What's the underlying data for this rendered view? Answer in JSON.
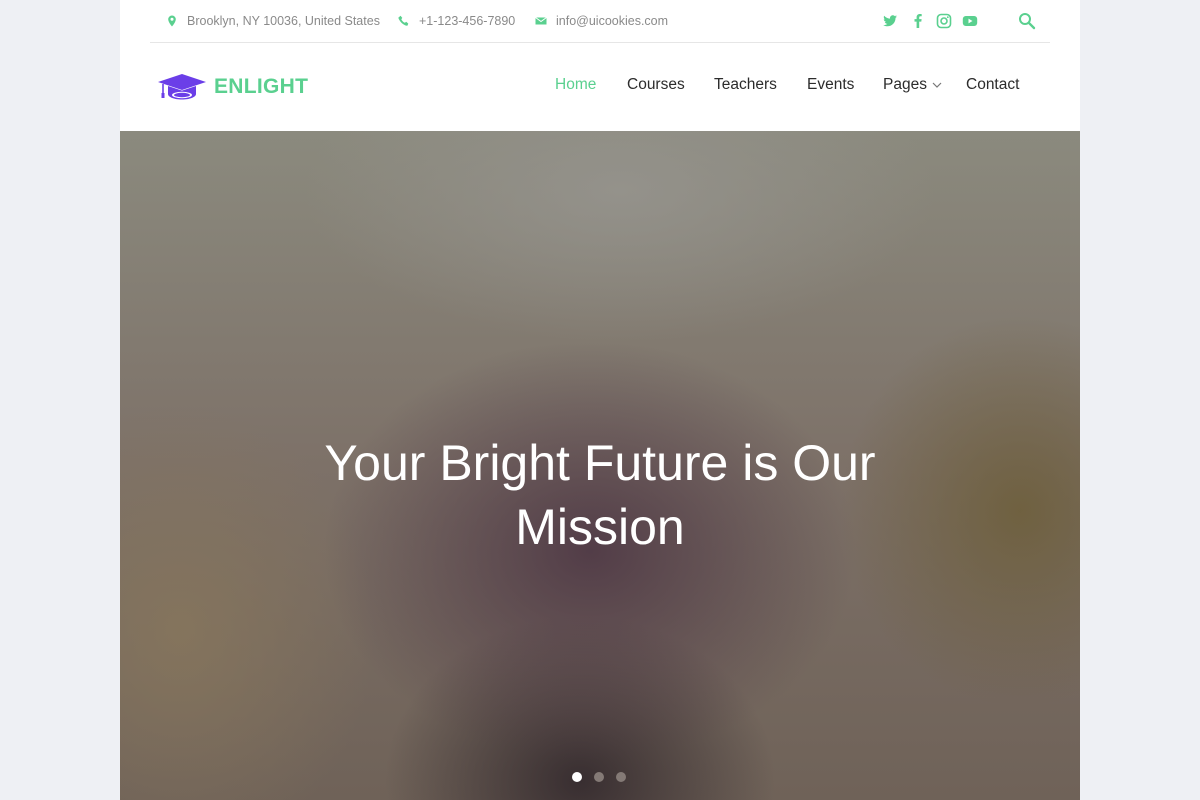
{
  "topbar": {
    "address": "Brooklyn, NY 10036, United States",
    "phone": "+1-123-456-7890",
    "email": "info@uicookies.com",
    "icon_color": "#5ad08f"
  },
  "brand": {
    "name": "ENLIGHT",
    "logo_icon": "graduation-cap-icon",
    "logo_color": "#6b3ee8",
    "accent_color": "#5ad08f"
  },
  "nav": {
    "items": [
      {
        "label": "Home",
        "active": true
      },
      {
        "label": "Courses"
      },
      {
        "label": "Teachers"
      },
      {
        "label": "Events"
      },
      {
        "label": "Pages",
        "has_dropdown": true
      },
      {
        "label": "Contact"
      }
    ]
  },
  "hero": {
    "title": "Your Bright Future is Our Mission",
    "slides": 3,
    "active_slide": 1
  }
}
